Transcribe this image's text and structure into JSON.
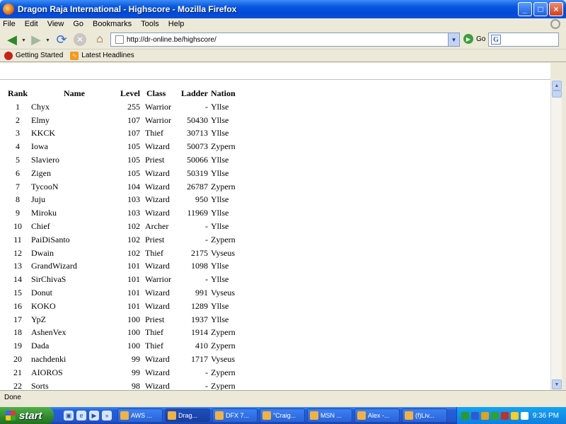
{
  "window": {
    "title": "Dragon Raja International - Highscore - Mozilla Firefox",
    "minimize": "_",
    "maximize": "□",
    "close": "×"
  },
  "menu": [
    "File",
    "Edit",
    "View",
    "Go",
    "Bookmarks",
    "Tools",
    "Help"
  ],
  "nav": {
    "url": "http://dr-online.be/highscore/",
    "go_label": "Go",
    "search_icon": "G"
  },
  "bookmarks": [
    "Getting Started",
    "Latest Headlines"
  ],
  "table": {
    "headers": [
      "Rank",
      "Name",
      "Level",
      "Class",
      "Ladder",
      "Nation"
    ],
    "rows": [
      [
        "1",
        "Chyx",
        "255",
        "Warrior",
        "-",
        "Yllse"
      ],
      [
        "2",
        "Elmy",
        "107",
        "Warrior",
        "50430",
        "Yllse"
      ],
      [
        "3",
        "KKCK",
        "107",
        "Thief",
        "30713",
        "Yllse"
      ],
      [
        "4",
        "Iowa",
        "105",
        "Wizard",
        "50073",
        "Zypern"
      ],
      [
        "5",
        "Slaviero",
        "105",
        "Priest",
        "50066",
        "Yllse"
      ],
      [
        "6",
        "Zigen",
        "105",
        "Wizard",
        "50319",
        "Yllse"
      ],
      [
        "7",
        "TycooN",
        "104",
        "Wizard",
        "26787",
        "Zypern"
      ],
      [
        "8",
        "Juju",
        "103",
        "Wizard",
        "950",
        "Yllse"
      ],
      [
        "9",
        "Miroku",
        "103",
        "Wizard",
        "11969",
        "Yllse"
      ],
      [
        "10",
        "Chief",
        "102",
        "Archer",
        "-",
        "Yllse"
      ],
      [
        "11",
        "PaiDiSanto",
        "102",
        "Priest",
        "-",
        "Zypern"
      ],
      [
        "12",
        "Dwain",
        "102",
        "Thief",
        "2175",
        "Vyseus"
      ],
      [
        "13",
        "GrandWizard",
        "101",
        "Wizard",
        "1098",
        "Yllse"
      ],
      [
        "14",
        "SirChivaS",
        "101",
        "Warrior",
        "-",
        "Yllse"
      ],
      [
        "15",
        "Donut",
        "101",
        "Wizard",
        "991",
        "Vyseus"
      ],
      [
        "16",
        "KOKO",
        "101",
        "Wizard",
        "1289",
        "Yllse"
      ],
      [
        "17",
        "YpZ",
        "100",
        "Priest",
        "1937",
        "Yllse"
      ],
      [
        "18",
        "AshenVex",
        "100",
        "Thief",
        "1914",
        "Zypern"
      ],
      [
        "19",
        "Dada",
        "100",
        "Thief",
        "410",
        "Zypern"
      ],
      [
        "20",
        "nachdenki",
        "99",
        "Wizard",
        "1717",
        "Vyseus"
      ],
      [
        "21",
        "AIOROS",
        "99",
        "Wizard",
        "-",
        "Zypern"
      ],
      [
        "22",
        "Sorts",
        "98",
        "Wizard",
        "-",
        "Zypern"
      ]
    ]
  },
  "status": "Done",
  "taskbar": {
    "start": "start",
    "tasks": [
      "AWS ...",
      "Drag...",
      "DFX 7...",
      "\"Craig...",
      "MSN ...",
      "Alex -...",
      "(f)Liv..."
    ],
    "active_index": 1,
    "clock": "9:36 PM"
  }
}
